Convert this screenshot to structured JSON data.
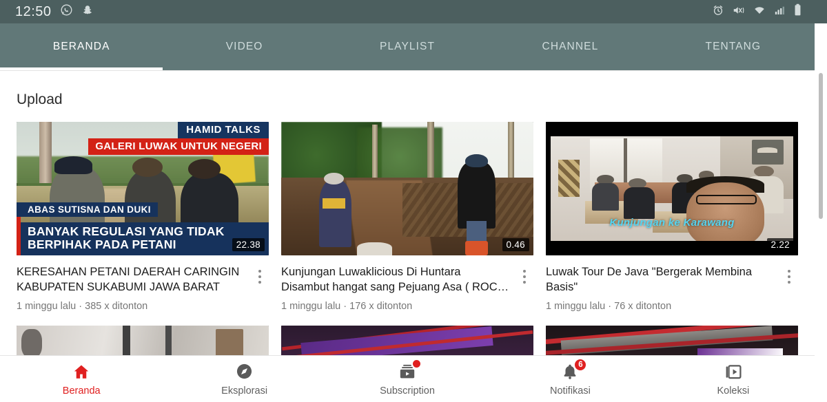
{
  "status_bar": {
    "time": "12:50",
    "left_icons": [
      "whatsapp-icon",
      "snapchat-icon"
    ],
    "right_icons": [
      "alarm-icon",
      "vibrate-mute-icon",
      "wifi-icon",
      "signal-icon",
      "battery-icon"
    ],
    "background_color": "#4c5f5f"
  },
  "tabs": {
    "background_color": "#617878",
    "active_index": 0,
    "items": [
      {
        "label": "BERANDA"
      },
      {
        "label": "VIDEO"
      },
      {
        "label": "PLAYLIST"
      },
      {
        "label": "CHANNEL"
      },
      {
        "label": "TENTANG"
      }
    ]
  },
  "main": {
    "section_title": "Upload",
    "videos": [
      {
        "title": "KERESAHAN PETANI DAERAH CARINGIN KABUPATEN SUKABUMI JAWA BARAT",
        "meta": "1 minggu lalu · 385 x ditonton",
        "duration": "22.38",
        "thumbnail_overlays": {
          "badge_top": "HAMID TALKS",
          "badge_red": "GALERI LUWAK UNTUK NEGERI",
          "name_bar": "ABAS SUTISNA DAN DUKI",
          "headline": "BANYAK REGULASI YANG TIDAK BERPIHAK PADA PETANI"
        }
      },
      {
        "title": "Kunjungan Luwaklicious Di Huntara Disambut hangat sang Pejuang Asa ( ROC…",
        "meta": "1 minggu lalu · 176 x ditonton",
        "duration": "0.46",
        "thumbnail_overlays": {}
      },
      {
        "title": "Luwak Tour De Java \"Bergerak Membina Basis\"",
        "meta": "1 minggu lalu · 76 x ditonton",
        "duration": "2.22",
        "thumbnail_overlays": {
          "caption": "Kunjungan ke Karawang"
        }
      }
    ]
  },
  "bottom_nav": {
    "active_index": 0,
    "active_color": "#e02020",
    "items": [
      {
        "label": "Beranda",
        "icon": "home-icon",
        "badge": ""
      },
      {
        "label": "Eksplorasi",
        "icon": "compass-icon",
        "badge": ""
      },
      {
        "label": "Subscription",
        "icon": "subscriptions-icon",
        "badge": "dot"
      },
      {
        "label": "Notifikasi",
        "icon": "bell-icon",
        "badge": "6"
      },
      {
        "label": "Koleksi",
        "icon": "library-icon",
        "badge": ""
      }
    ]
  }
}
